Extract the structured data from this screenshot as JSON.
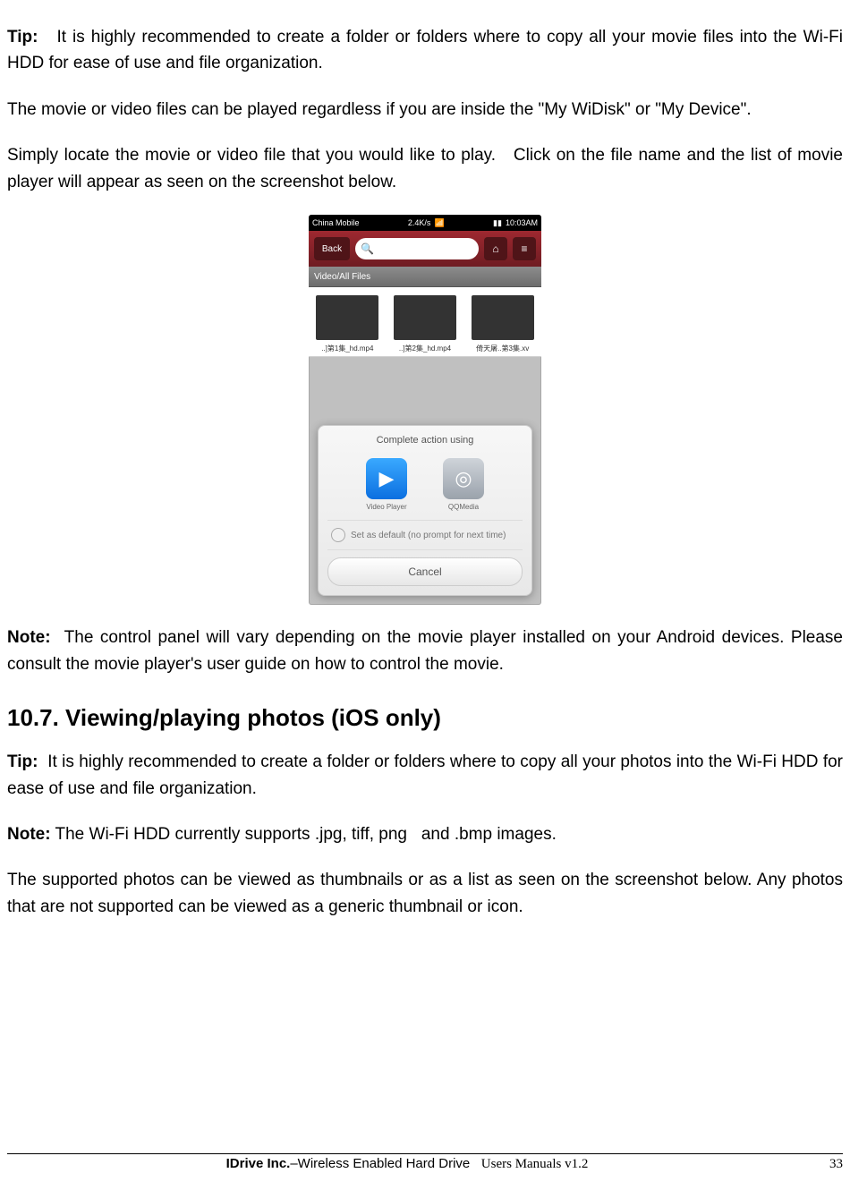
{
  "tip1_label": "Tip:",
  "tip1_text": "It is highly recommended to create a folder or folders where to copy all your movie files into the Wi-Fi HDD for ease of use and file organization.",
  "para2": "The movie or video files can be played regardless if you are inside the \"My WiDisk\" or \"My Device\".",
  "para3": "Simply locate the movie or video file that you would like to play.   Click on the file name and the list of movie player will appear as seen on the screenshot below.",
  "note1_label": "Note:",
  "note1_text": "The control panel will vary depending on the movie player installed on your Android devices. Please consult the movie player's user guide on how to control the movie.",
  "section_heading": "10.7. Viewing/playing photos (iOS only)",
  "tip2_label": "Tip:",
  "tip2_text": "It is highly recommended to create a folder or folders where to copy all your photos into the Wi-Fi HDD for ease of use and file organization.",
  "note2_label": "Note:",
  "note2_text": " The Wi-Fi HDD currently supports .jpg, tiff, png   and .bmp images.",
  "para_last": "The supported photos can be viewed as thumbnails or as a list as seen on the screenshot below. Any photos that are not supported can be viewed as a generic thumbnail or icon.",
  "footer_company": "IDrive Inc.",
  "footer_mid": "–Wireless Enabled Hard Drive",
  "footer_right": "Users Manuals v1.2",
  "page_number": "33",
  "screenshot": {
    "statusbar": {
      "carrier": "China Mobile",
      "speed": "2.4K/s",
      "time": "10:03AM"
    },
    "navbar": {
      "back": "Back",
      "search_placeholder": ""
    },
    "pathbar": "Video/All Files",
    "thumbs": [
      "..]第1集_hd.mp4",
      "..]第2集_hd.mp4",
      "倚天屠..第3集.xv"
    ],
    "sheet_title": "Complete action using",
    "app1": "Video Player",
    "app2": "QQMedia",
    "default_text": "Set as default (no prompt for next time)",
    "cancel": "Cancel"
  }
}
